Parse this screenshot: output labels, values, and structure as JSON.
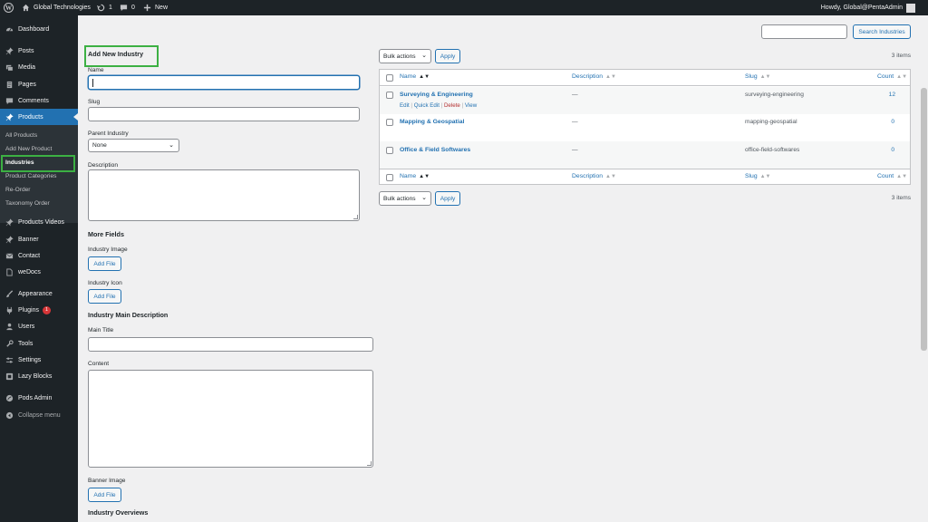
{
  "adminbar": {
    "site_name": "Global Technologies",
    "updates_count": "1",
    "comments_count": "0",
    "new_label": "New",
    "howdy": "Howdy, Global@PentaAdmin"
  },
  "sidebar": {
    "dashboard": "Dashboard",
    "posts": "Posts",
    "media": "Media",
    "pages": "Pages",
    "comments": "Comments",
    "products": "Products",
    "submenu": {
      "all_products": "All Products",
      "add_new_product": "Add New Product",
      "industries": "Industries",
      "product_categories": "Product Categories",
      "re_order": "Re-Order",
      "taxonomy_order": "Taxonomy Order"
    },
    "products_videos": "Products Videos",
    "banner": "Banner",
    "contact": "Contact",
    "wedocs": "weDocs",
    "appearance": "Appearance",
    "plugins": "Plugins",
    "plugins_badge": "1",
    "users": "Users",
    "tools": "Tools",
    "settings": "Settings",
    "lazy_blocks": "Lazy Blocks",
    "pods_admin": "Pods Admin",
    "collapse": "Collapse menu"
  },
  "form": {
    "heading": "Add New Industry",
    "name_label": "Name",
    "name_value": "",
    "slug_label": "Slug",
    "slug_value": "",
    "parent_label": "Parent Industry",
    "parent_value": "None",
    "description_label": "Description",
    "more_fields": "More Fields",
    "industry_image": "Industry Image",
    "add_file": "Add File",
    "industry_icon": "Industry Icon",
    "main_description": "Industry Main Description",
    "main_title": "Main Title",
    "content": "Content",
    "banner_image": "Banner Image",
    "overviews": "Industry Overviews"
  },
  "search": {
    "value": "",
    "button": "Search Industries"
  },
  "table": {
    "bulk_actions": "Bulk actions",
    "apply": "Apply",
    "items_count": "3 items",
    "columns": {
      "name": "Name",
      "description": "Description",
      "slug": "Slug",
      "count": "Count"
    },
    "rows": [
      {
        "name": "Surveying & Engineering",
        "description": "—",
        "slug": "surveying-engineering",
        "count": "12"
      },
      {
        "name": "Mapping & Geospatial",
        "description": "—",
        "slug": "mapping-geospatial",
        "count": "0"
      },
      {
        "name": "Office & Field Softwares",
        "description": "—",
        "slug": "office-field-softwares",
        "count": "0"
      }
    ],
    "row_actions": {
      "edit": "Edit",
      "quick_edit": "Quick Edit",
      "delete": "Delete",
      "view": "View"
    }
  },
  "colors": {
    "admin_dark": "#1d2327",
    "accent_blue": "#2271b1",
    "highlight_green": "#3cb043",
    "delete_red": "#b32d2e"
  }
}
